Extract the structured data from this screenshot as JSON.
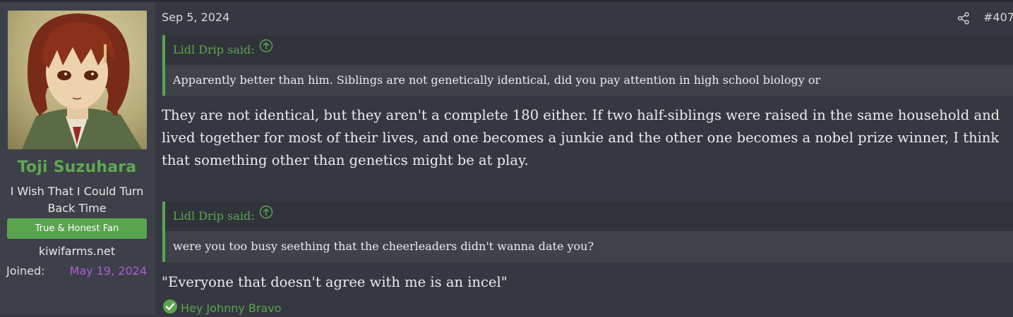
{
  "user": {
    "name": "Toji Suzuhara",
    "title": "I Wish That I Could Turn Back Time",
    "banner": "True & Honest Fan",
    "site": "kiwifarms.net",
    "joined_label": "Joined:",
    "joined_value": "May 19, 2024",
    "colors": {
      "name": "#60a855",
      "banner": "#5aa44f",
      "joined_value": "#b05ad8"
    }
  },
  "post": {
    "date": "Sep 5, 2024",
    "number": "#407",
    "share_icon": "share-icon",
    "quote1": {
      "author": "Lidl Drip said:",
      "body": "Apparently better than him. Siblings are not genetically identical, did you pay attention in high school biology or"
    },
    "reply1": "They are not identical, but they aren't a complete 180 either. If two half-siblings were raised in the same household and lived together for most of their lives, and one becomes a junkie and the other one becomes a nobel prize winner, I think that something other than genetics might be at play.",
    "quote2": {
      "author": "Lidl Drip said:",
      "body": "were you too busy seething that the cheerleaders didn't wanna date you?"
    },
    "reply2": "\"Everyone that doesn't agree with me is an incel\"",
    "reaction": "Hey Johnny Bravo",
    "accent": "#5aa44f"
  }
}
